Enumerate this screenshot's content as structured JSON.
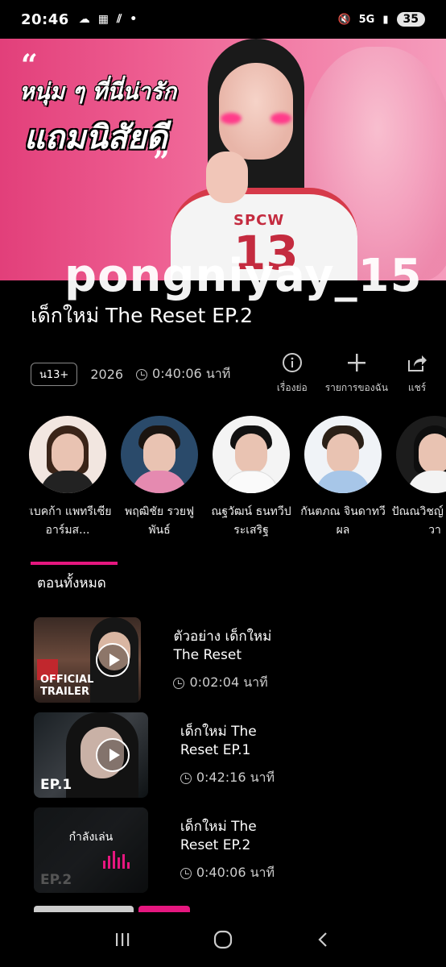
{
  "status_bar": {
    "time": "20:46",
    "signal": "5G",
    "battery": "35"
  },
  "hero": {
    "tagline_line1": "หนุ่ม ๆ ที่นี่น่ารัก",
    "tagline_line2": "แถมนิสัยดี",
    "shirt_text": "SPCW",
    "shirt_number": "13"
  },
  "watermark": "pongniyay_15",
  "title": "เด็กใหม่ The Reset EP.2",
  "meta": {
    "rating": "น13+",
    "year": "2026",
    "duration": "0:40:06 นาที"
  },
  "actions": [
    {
      "label": "เรื่องย่อ",
      "icon": "info-icon"
    },
    {
      "label": "รายการของฉัน",
      "icon": "plus-icon"
    },
    {
      "label": "แชร์",
      "icon": "share-icon"
    }
  ],
  "cast": [
    {
      "name": "รีเบคก้า แพทรีเซีย อาร์มส...",
      "bg": "#f2e6e0"
    },
    {
      "name": "พฤฒิชัย รวยฟูพันธ์",
      "bg": "#2a4a6a"
    },
    {
      "name": "ณฐวัฒน์ ธนทวีประเสริฐ",
      "bg": "#f4f4f4"
    },
    {
      "name": "กันตภณ จินดาทวีผล",
      "bg": "#f0f3f7"
    },
    {
      "name": "ปัณณวิชญ์ เกียรติวา",
      "bg": "#1c1c1c"
    }
  ],
  "episodes_tab": "ตอนทั้งหมด",
  "episodes": [
    {
      "title": "ตัวอย่าง เด็กใหม่ The Reset",
      "duration": "0:02:04 นาที",
      "thumb_label": "OFFICIAL TRAILER",
      "playing": false
    },
    {
      "title": "เด็กใหม่ The Reset EP.1",
      "duration": "0:42:16 นาที",
      "thumb_label": "EP.1",
      "playing": false
    },
    {
      "title": "เด็กใหม่ The Reset EP.2",
      "duration": "0:40:06 นาที",
      "thumb_label": "EP.2",
      "playing": true,
      "playing_label": "กำลังเล่น"
    }
  ],
  "colors": {
    "accent": "#e5177f",
    "hero_pink": "#ee5f92",
    "background": "#000000"
  }
}
